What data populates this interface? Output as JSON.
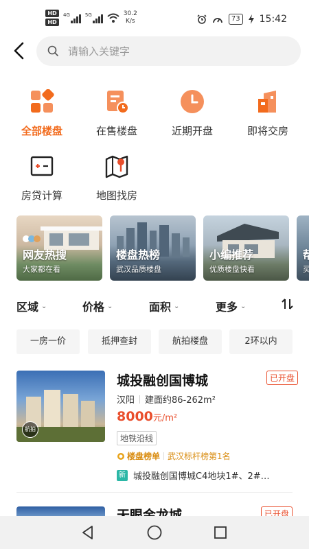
{
  "status_bar": {
    "hd1": "HD 1",
    "hd2": "HD 2",
    "sig1": "4G",
    "sig2": "5G",
    "net_speed": "30.2",
    "net_unit": "K/s",
    "battery": "73",
    "time": "15:42"
  },
  "search": {
    "placeholder": "请输入关键字"
  },
  "categories": [
    {
      "label": "全部楼盘",
      "icon": "grid-icon",
      "active": true
    },
    {
      "label": "在售楼盘",
      "icon": "document-clock-icon",
      "active": false
    },
    {
      "label": "近期开盘",
      "icon": "clock-icon",
      "active": false
    },
    {
      "label": "即将交房",
      "icon": "building-icon",
      "active": false
    },
    {
      "label": "房贷计算",
      "icon": "calculator-icon",
      "active": false
    },
    {
      "label": "地图找房",
      "icon": "map-pin-icon",
      "active": false
    }
  ],
  "banners": [
    {
      "title": "网友热搜",
      "subtitle": "大家都在看"
    },
    {
      "title": "楼盘热榜",
      "subtitle": "武汉品质楼盘"
    },
    {
      "title": "小编推荐",
      "subtitle": "优质楼盘快看"
    },
    {
      "title": "帮",
      "subtitle": "买"
    }
  ],
  "filters": {
    "area": "区域",
    "price": "价格",
    "size": "面积",
    "more": "更多"
  },
  "tags": [
    "一房一价",
    "抵押查封",
    "航拍楼盘",
    "2环以内"
  ],
  "listing": {
    "title": "城投融创国博城",
    "badge": "已开盘",
    "district": "汉阳",
    "area": "建面约86-262m²",
    "price": "8000",
    "price_unit": "元/m²",
    "feature": "地铁沿线",
    "rank_label": "楼盘榜单",
    "rank_text": "武汉标杆榜第1名",
    "news_badge": "新",
    "news": "城投融创国博城C4地块1#、2#…",
    "aerial_label": "航拍"
  },
  "next_listing": {
    "title": "天眼金龙城",
    "badge": "已开盘"
  },
  "colors": {
    "accent": "#f26b1d",
    "price": "#e94e2c",
    "rank": "#d98c10"
  }
}
